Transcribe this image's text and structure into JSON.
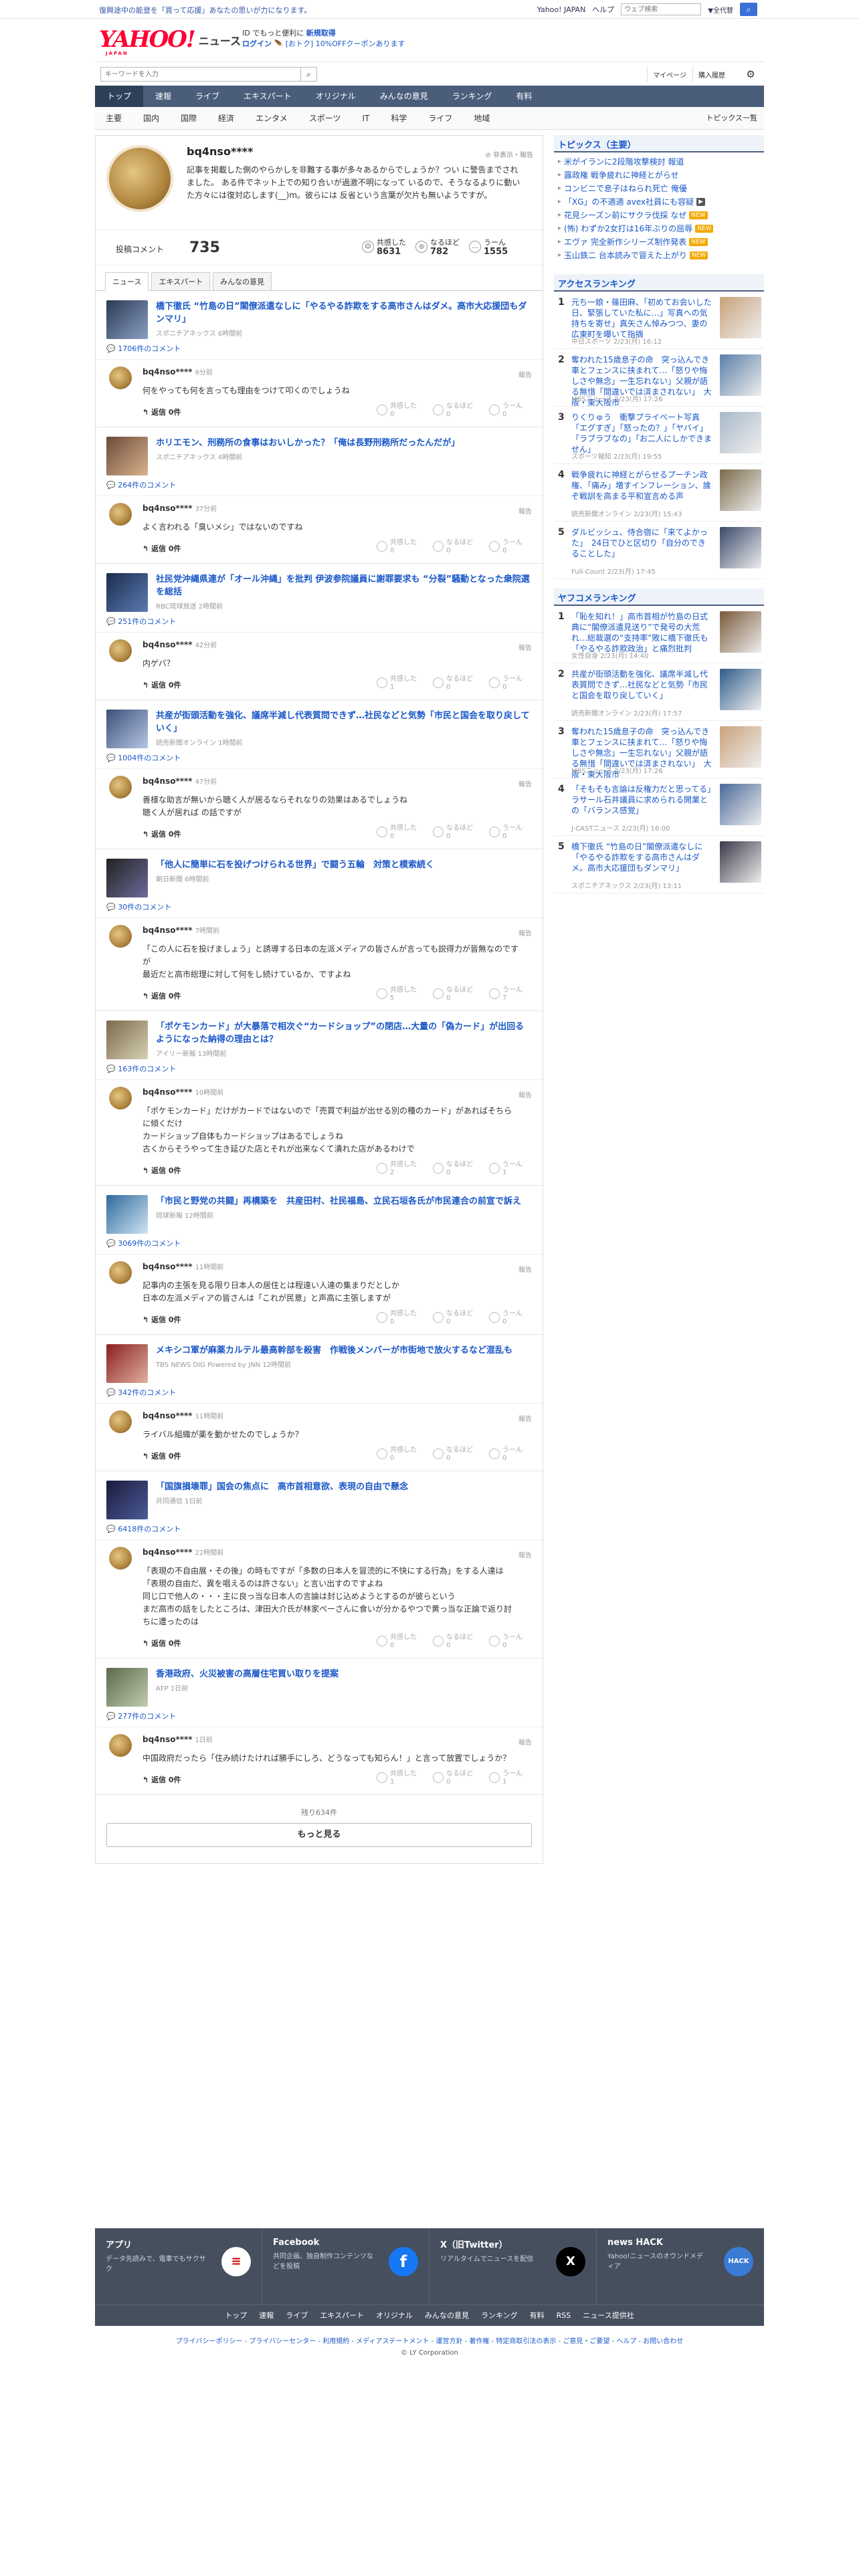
{
  "topbar": {
    "campaign": "復興途中の能登を「買って応援」あなたの思いが力になります。",
    "links": [
      "Yahoo! JAPAN",
      "ヘルプ"
    ],
    "search_placeholder": "ウェブ検索",
    "search_btn": "▼全代替",
    "search_go": "検索"
  },
  "header": {
    "logo_text": "YAHOO!",
    "logo_sub": "JAPAN",
    "service": "ニュース",
    "promo_line1a": "ID でもっと便利に",
    "promo_line1b": "新規取得",
    "promo_line2a": "ログイン",
    "promo_line2b": "[おトク] 10%OFFクーポンあります"
  },
  "search": {
    "placeholder": "キーワードを入力",
    "mypage": "マイページ",
    "history": "購入履歴"
  },
  "catnav": [
    "トップ",
    "速報",
    "ライブ",
    "エキスパート",
    "オリジナル",
    "みんなの意見",
    "ランキング",
    "有料"
  ],
  "subnav": {
    "items": [
      "主要",
      "国内",
      "国際",
      "経済",
      "エンタメ",
      "スポーツ",
      "IT",
      "科学",
      "ライフ",
      "地域"
    ],
    "list_link": "トピックス一覧"
  },
  "profile": {
    "name": "bq4nso****",
    "report": "非表示・報告",
    "bio": "記事を掲載した側のやらかしを非難する事が多々あるからでしょうか？つい に警告までされました。 ある件でネット上での知り合いが過激不明になって いるので、そうなるよりに動いた方々には復対応します(__)m。彼らには 反省という言葉が欠片も無いようですが。",
    "comments_label": "投稿コメント",
    "comments_count": "735",
    "stats": [
      {
        "label": "共感した",
        "value": "8631"
      },
      {
        "label": "なるほど",
        "value": "782"
      },
      {
        "label": "うーん",
        "value": "1555"
      }
    ]
  },
  "tabs": [
    "ニュース",
    "エキスパート",
    "みんなの意見"
  ],
  "entries": [
    {
      "title": "橋下徹氏 “竹島の日”閣僚派遣なしに「やるやる詐欺をする高市さんはダメ。高市大応援団もダンマリ」",
      "source": "スポニチアネックス 6時間前",
      "comment_count": "1706件のコメント",
      "user": "bq4nso****",
      "time": "6分前",
      "report": "報告",
      "body": "何をやっても何を言っても理由をつけて叩くのでしょうね",
      "reply": "返信 0件",
      "r1": "共感した\n0",
      "r2": "なるほど\n0",
      "r3": "うーん\n0"
    },
    {
      "title": "ホリエモン、刑務所の食事はおいしかった？「俺は長野刑務所だったんだが」",
      "source": "スポニチアネックス 4時間前",
      "comment_count": "264件のコメント",
      "user": "bq4nso****",
      "time": "37分前",
      "report": "報告",
      "body": "よく言われる「臭いメシ」ではないのですね",
      "reply": "返信 0件",
      "r1": "共感した\n0",
      "r2": "なるほど\n0",
      "r3": "うーん\n0"
    },
    {
      "title": "社民党沖縄県連が「オール沖縄」を批判 伊波参院議員に謝罪要求も “分裂”騒動となった衆院選を総括",
      "source": "RBC琉球放送 2時間前",
      "comment_count": "251件のコメント",
      "user": "bq4nso****",
      "time": "42分前",
      "report": "報告",
      "body": "内ゲバ？",
      "reply": "返信 0件",
      "r1": "共感した\n1",
      "r2": "なるほど\n0",
      "r3": "うーん\n0"
    },
    {
      "title": "共産が街頭活動を強化、議席半減し代表質問できず…社民などと気勢「市民と国会を取り戻していく」",
      "source": "読売新聞オンライン 1時間前",
      "comment_count": "1004件のコメント",
      "user": "bq4nso****",
      "time": "47分前",
      "report": "報告",
      "body": "善様な助言が無いから聴く人が居るならそれなりの効果はあるでしょうね\n聴く人が居れば の話ですが",
      "reply": "返信 0件",
      "r1": "共感した\n0",
      "r2": "なるほど\n0",
      "r3": "うーん\n0"
    },
    {
      "title": "「他人に簡単に石を投げつけられる世界」で闘う五輪　対策と模索続く",
      "source": "朝日新聞 6時間前",
      "comment_count": "30件のコメント",
      "user": "bq4nso****",
      "time": "7時間前",
      "report": "報告",
      "body": "「この人に石を投げましょう」と誘導する日本の左派メディアの皆さんが言っても説得力が皆無なのですが\n最近だと高市総理に対して何をし続けているか、ですよね",
      "reply": "返信 0件",
      "r1": "共感した\n5",
      "r2": "なるほど\n0",
      "r3": "うーん\n7"
    },
    {
      "title": "「ポケモンカード」が大暴落で相次ぐ“カードショップ”の閉店…大量の「偽カード」が出回るようになった納得の理由とは？",
      "source": "アイリー新報 13時間前",
      "comment_count": "163件のコメント",
      "user": "bq4nso****",
      "time": "10時間前",
      "report": "報告",
      "body": "「ポケモンカード」だけがカードではないので「売買で利益が出せる別の種のカード」があればそちらに傾くだけ\nカードショップ自体もカードショップはあるでしょうね\n古くからそうやって生き延びた店とそれが出来なくて潰れた店があるわけで",
      "reply": "返信 0件",
      "r1": "共感した\n2",
      "r2": "なるほど\n0",
      "r3": "うーん\n1"
    },
    {
      "title": "「市民と野党の共闘」再構築を　共産田村、社民福島、立民石垣各氏が市民連合の前宣で訴え",
      "source": "琉球新報 12時間前",
      "comment_count": "3069件のコメント",
      "user": "bq4nso****",
      "time": "11時間前",
      "report": "報告",
      "body": "記事内の主張を見る限り日本人の居住とは程遠い人達の集まりだとしか\n日本の左派メディアの皆さんは「これが民意」と声高に主張しますが",
      "reply": "返信 0件",
      "r1": "共感した\n0",
      "r2": "なるほど\n0",
      "r3": "うーん\n0"
    },
    {
      "title": "メキシコ軍が麻薬カルテル最高幹部を殺害　作戦後メンバーが市街地で放火するなど混乱も",
      "source": "TBS NEWS DIG Powered by JNN 12時間前",
      "comment_count": "342件のコメント",
      "user": "bq4nso****",
      "time": "11時間前",
      "report": "報告",
      "body": "ライバル組織が薬を動かせたのでしょうか？",
      "reply": "返信 0件",
      "r1": "共感した\n0",
      "r2": "なるほど\n0",
      "r3": "うーん\n0"
    },
    {
      "title": "「国旗損壊罪」国会の焦点に　高市首相意欲、表現の自由で懸念",
      "source": "共同通信 1日前",
      "comment_count": "6418件のコメント",
      "user": "bq4nso****",
      "time": "22時間前",
      "report": "報告",
      "body": "「表現の不自由展・その後」の時もですが「多数の日本人を冒涜的に不快にする行為」をする人達は「表現の自由だ、異を唱えるのは許さない」と言い出すのですよね\n同じ口で他人の・・・主に良っ当な日本人の言論は封じ込めようとするのが彼らという\nまだ高市の話をしたところは、津田大介氏が林家ぺーさんに食いが分かるやつで黄っ当な正論で返り討ちに遭ったのは",
      "reply": "返信 0件",
      "r1": "共感した\n0",
      "r2": "なるほど\n0",
      "r3": "うーん\n0"
    },
    {
      "title": "香港政府、火災被害の高層住宅買い取りを提案",
      "source": "AFP 1日前",
      "comment_count": "277件のコメント",
      "user": "bq4nso****",
      "time": "1日前",
      "report": "報告",
      "body": "中国政府だったら「住み続けたければ勝手にしろ、どうなっても知らん！」と言って放置でしょうか？",
      "reply": "返信 0件",
      "r1": "共感した\n1",
      "r2": "なるほど\n0",
      "r3": "うーん\n1"
    }
  ],
  "more": {
    "remaining": "残り634件",
    "button": "もっと見る"
  },
  "side": {
    "topics_header": "トピックス（主要）",
    "topics": [
      {
        "text": "米がイランに2段階攻撃検討 報道",
        "badge": ""
      },
      {
        "text": "露政権 戦争疲れに神経とがらせ",
        "badge": ""
      },
      {
        "text": "コンビニで息子はねられ死亡 俺優",
        "badge": ""
      },
      {
        "text": "「XG」の不適適 avex社員にも容疑",
        "badge": "▶"
      },
      {
        "text": "花見シーズン前にサクラ伐採 なぜ",
        "badge": "NEW"
      },
      {
        "text": "(怖) わずか2女打は16年ぶりの屈辱",
        "badge": "NEW"
      },
      {
        "text": "エヴァ 完全新作シリーズ制作発表",
        "badge": "NEW"
      },
      {
        "text": "玉山鉄二 台本読みで冒えた上がり",
        "badge": "NEW"
      }
    ],
    "access_header": "アクセスランキング",
    "access": [
      {
        "n": "1",
        "t": "元ち一娘・篠田麻、「初めてお会いした日、緊張していた私に…」写真への気持ちを寄せ」真矢さん悼みつつ、妻の広東町を曝いて指摘",
        "s": "中日スポーツ 2/23(月) 16:12"
      },
      {
        "n": "2",
        "t": "奪われた15歳息子の命　突っ込んでき車とフェンスに挟まれて…「怒りや悔しさや無念」一生忘れない」父親が語る無惜「間違いでは済まされない」　大阪・東大阪市",
        "s": "MBSニュース 2/23(月) 17:26"
      },
      {
        "n": "3",
        "t": "りくりゅう　衝撃プライベート写真「エグすぎ」「怒ったの？」「ヤバイ」「ラブラブなの」「お二人にしかできません」",
        "s": "スポーツ報知 2/23(月) 19:55"
      },
      {
        "n": "4",
        "t": "戦争疲れに神経とがらせるプーチン政権、「痛み」増すインフレーション、誰ぞ戦訓を高まる平和宣言める声",
        "s": "読売新聞オンライン 2/23(月) 15:43"
      },
      {
        "n": "5",
        "t": "ダルビッシュ、侍合宿に「来てよかった」　24日でひと区切り「自分のできることした」",
        "s": "Full-Count 2/23(月) 17:45"
      }
    ],
    "yafuko_header": "ヤフコメランキング",
    "yafuko": [
      {
        "n": "1",
        "t": "「恥を知れ！」高市首相が竹島の日式典に“閣僚派遣見送り”で発号の大荒れ…総裁選の“支持率”敗に橋下徹氏も「やるやる詐欺政治」と痛烈批判",
        "s": "女性自身 2/23(月) 14:40"
      },
      {
        "n": "2",
        "t": "共産が街頭活動を強化、議席半減し代表質問できず…社民などと気勢「市民と国会を取り戻していく」",
        "s": "読売新聞オンライン 2/23(月) 17:57"
      },
      {
        "n": "3",
        "t": "奪われた15歳息子の命　突っ込んでき車とフェンスに挟まれて…「怒りや悔しさや無念」一生忘れない」父親が語る無惜「間違いでは済まされない」　大阪・東大阪市",
        "s": "MBSニュース 2/23(月) 17:26"
      },
      {
        "n": "4",
        "t": "「そもそも言論は反権力だと思ってる」ラサール石井議員に求められる開業との「バランス感覚」",
        "s": "J-CASTニュース 2/23(月) 16:00"
      },
      {
        "n": "5",
        "t": "橋下徹氏 “竹島の日”閣僚派遣なしに「やるやる詐欺をする高市さんはダメ。高市大応援団もダンマリ」",
        "s": "スポニチアネックス 2/23(月) 13:11"
      }
    ]
  },
  "footer": {
    "cells": [
      {
        "title": "アプリ",
        "desc": "データ先読みで、電車でもサクサク",
        "icon": "≡"
      },
      {
        "title": "Facebook",
        "desc": "共同企画、独自制作コンテンツなどを投稿",
        "icon": "f"
      },
      {
        "title": "X（旧Twitter）",
        "desc": "リアルタイムでニュースを配信",
        "icon": "X"
      },
      {
        "title": "news HACK",
        "desc": "Yahoo!ニュースのオウンドメディア",
        "icon": "HACK"
      }
    ],
    "nav": [
      "トップ",
      "速報",
      "ライブ",
      "エキスパート",
      "オリジナル",
      "みんなの意見",
      "ランキング",
      "有料",
      "RSS",
      "ニュース提供社"
    ],
    "legal": "プライバシーポリシー - プライバシーセンター - 利用規約 - メディアステートメント - 運営方針 - 著作権 - 特定商取引法の表示 - ご意見・ご要望 - ヘルプ - お問い合わせ",
    "copy": "© LY Corporation"
  },
  "colors": {
    "accent": "#1a58c8",
    "nav_bg": "#4a5e7c",
    "footer_bg": "#454f5e",
    "logo_red": "#ff0033"
  }
}
